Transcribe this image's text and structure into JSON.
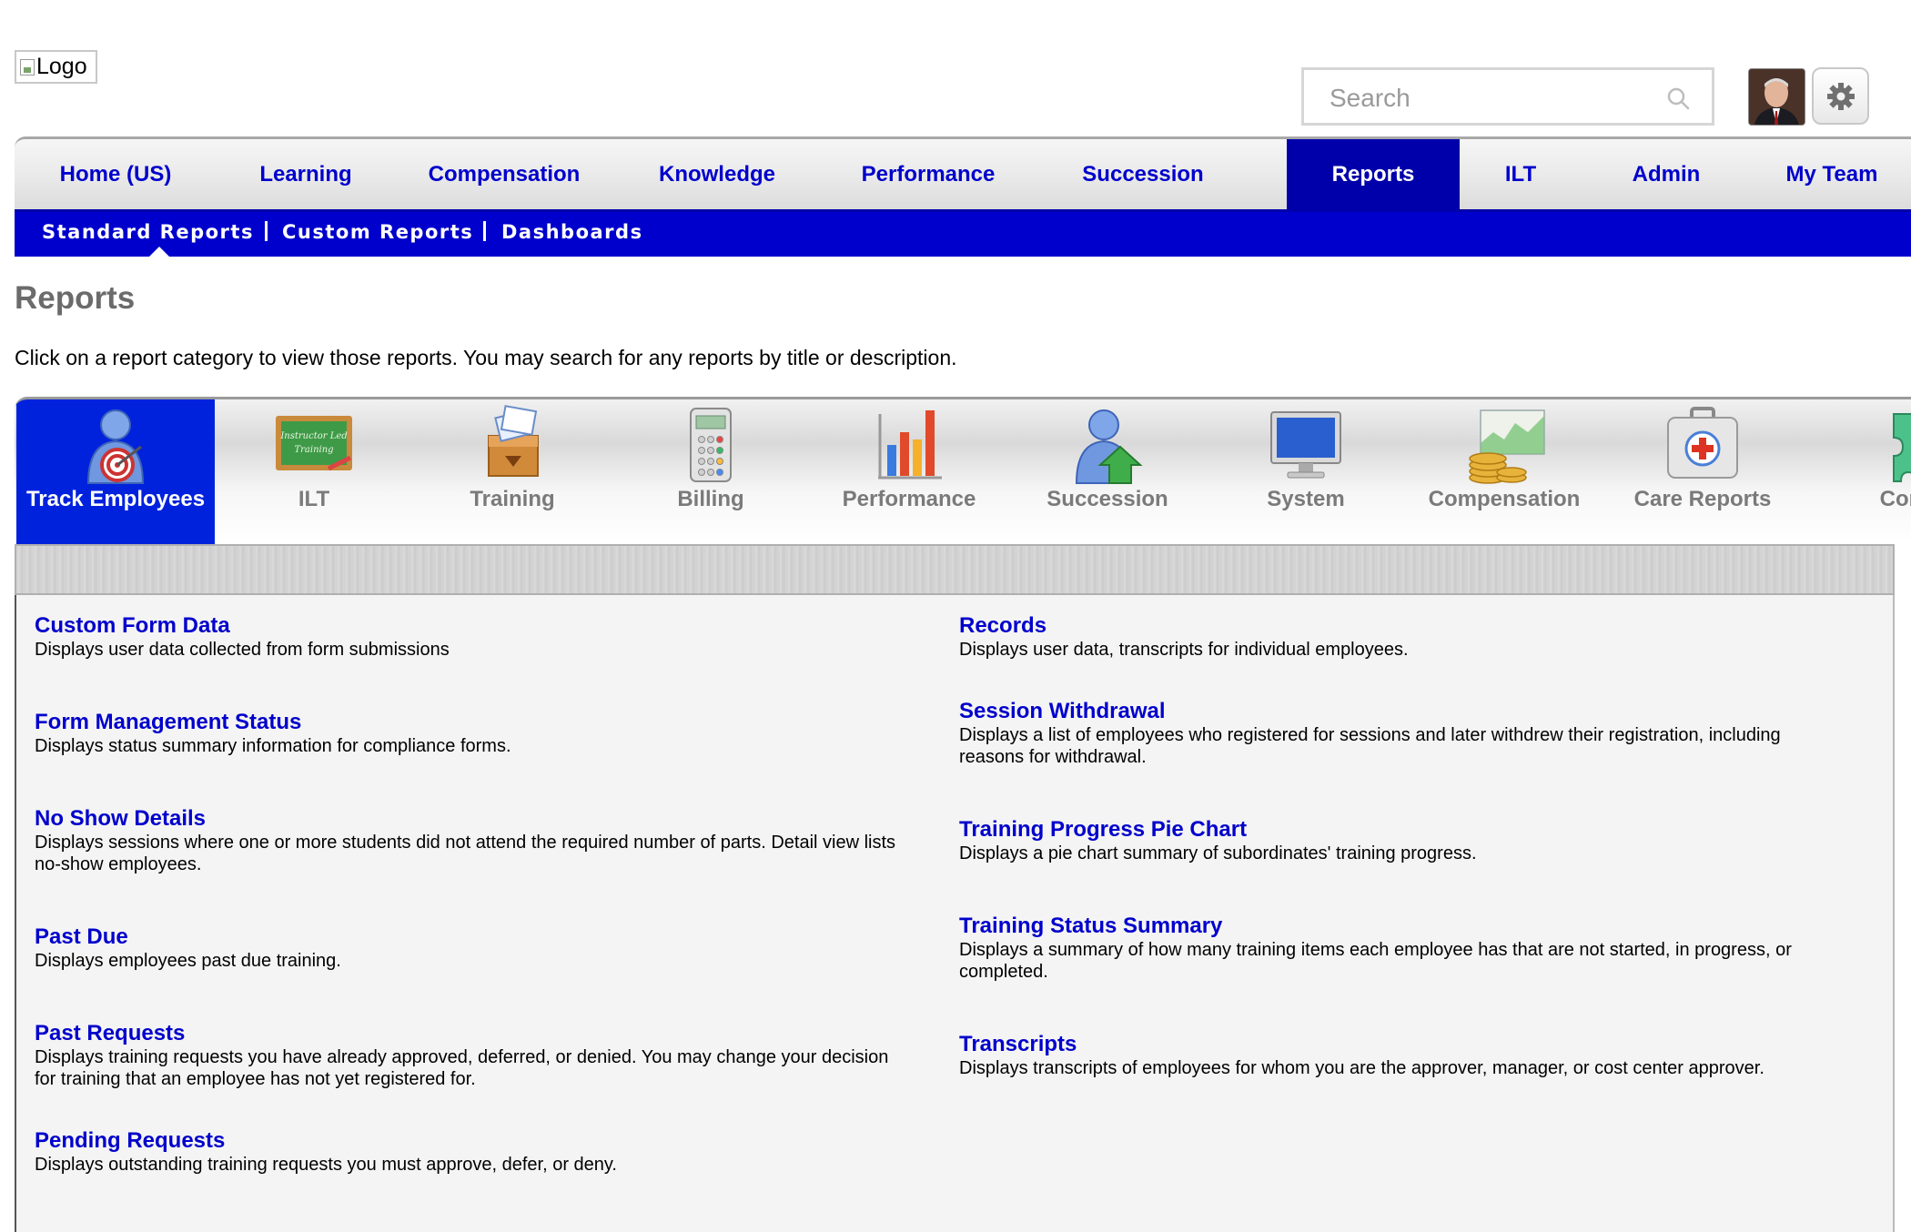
{
  "header": {
    "logo_alt": "Logo",
    "search_placeholder": "Search"
  },
  "main_nav": {
    "items": [
      {
        "label": "Home (US)"
      },
      {
        "label": "Learning"
      },
      {
        "label": "Compensation"
      },
      {
        "label": "Knowledge"
      },
      {
        "label": "Performance"
      },
      {
        "label": "Succession"
      },
      {
        "label": "Reports"
      },
      {
        "label": "ILT"
      },
      {
        "label": "Admin"
      },
      {
        "label": "My Team"
      }
    ],
    "active": "Reports"
  },
  "sub_nav": {
    "items": [
      {
        "label": "Standard Reports"
      },
      {
        "label": "Custom Reports"
      },
      {
        "label": "Dashboards"
      }
    ],
    "active": "Standard Reports"
  },
  "page": {
    "title": "Reports",
    "intro": "Click on a report category to view those reports. You may search for any reports by title or description."
  },
  "categories": {
    "items": [
      {
        "label": "Track Employees",
        "icon": "track-employees-icon"
      },
      {
        "label": "ILT",
        "icon": "ilt-icon"
      },
      {
        "label": "Training",
        "icon": "training-icon"
      },
      {
        "label": "Billing",
        "icon": "billing-icon"
      },
      {
        "label": "Performance",
        "icon": "performance-icon"
      },
      {
        "label": "Succession",
        "icon": "succession-icon"
      },
      {
        "label": "System",
        "icon": "system-icon"
      },
      {
        "label": "Compensation",
        "icon": "compensation-icon"
      },
      {
        "label": "Care Reports",
        "icon": "care-reports-icon"
      },
      {
        "label": "Con",
        "icon": "puzzle-icon"
      }
    ],
    "active": "Track Employees",
    "ilt_board_text": "Instructor Led Training"
  },
  "reports": {
    "left": [
      {
        "title": "Custom Form Data",
        "desc": "Displays user data collected from form submissions"
      },
      {
        "title": "Form Management Status",
        "desc": "Displays status summary information for compliance forms."
      },
      {
        "title": "No Show Details",
        "desc": "Displays sessions where one or more students did not attend the required number of parts. Detail view lists no-show employees."
      },
      {
        "title": "Past Due",
        "desc": "Displays employees past due training."
      },
      {
        "title": "Past Requests",
        "desc": "Displays training requests you have already approved, deferred, or denied. You may change your decision for training that an employee has not yet registered for."
      },
      {
        "title": "Pending Requests",
        "desc": "Displays outstanding training requests you must approve, defer, or deny."
      }
    ],
    "right": [
      {
        "title": "Records",
        "desc": "Displays user data, transcripts for individual employees."
      },
      {
        "title": "Session Withdrawal",
        "desc": "Displays a list of employees who registered for sessions and later withdrew their registration, including reasons for withdrawal."
      },
      {
        "title": "Training Progress Pie Chart",
        "desc": "Displays a pie chart summary of subordinates' training progress."
      },
      {
        "title": "Training Status Summary",
        "desc": "Displays a summary of how many training items each employee has that are not started, in progress, or completed."
      },
      {
        "title": "Transcripts",
        "desc": "Displays transcripts of employees for whom you are the approver, manager, or cost center approver."
      }
    ]
  }
}
